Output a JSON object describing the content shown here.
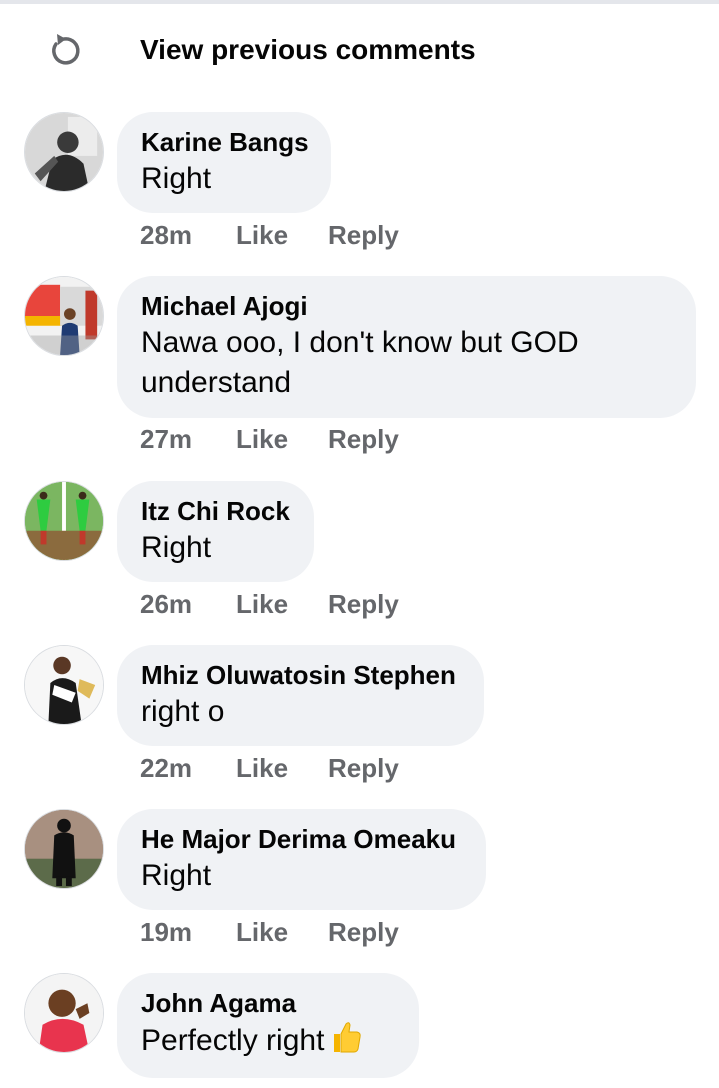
{
  "header": {
    "view_previous": "View previous comments",
    "icon": "refresh-icon"
  },
  "actions": {
    "like": "Like",
    "reply": "Reply"
  },
  "comments": [
    {
      "author": "Karine Bangs",
      "text": "Right",
      "time": "28m"
    },
    {
      "author": "Michael Ajogi",
      "text": "Nawa ooo, I don't know but GOD understand",
      "time": "27m"
    },
    {
      "author": "Itz Chi Rock",
      "text": "Right",
      "time": "26m"
    },
    {
      "author": "Mhiz Oluwatosin Stephen",
      "text": "right o",
      "time": "22m"
    },
    {
      "author": "He Major Derima Omeaku",
      "text": "Right",
      "time": "19m"
    },
    {
      "author": "John Agama",
      "text": "Perfectly right",
      "time": "",
      "emoji": "thumbs-up-emoji"
    }
  ],
  "colors": {
    "bubble": "#f0f2f5",
    "meta_text": "#65676b",
    "text": "#050505"
  }
}
